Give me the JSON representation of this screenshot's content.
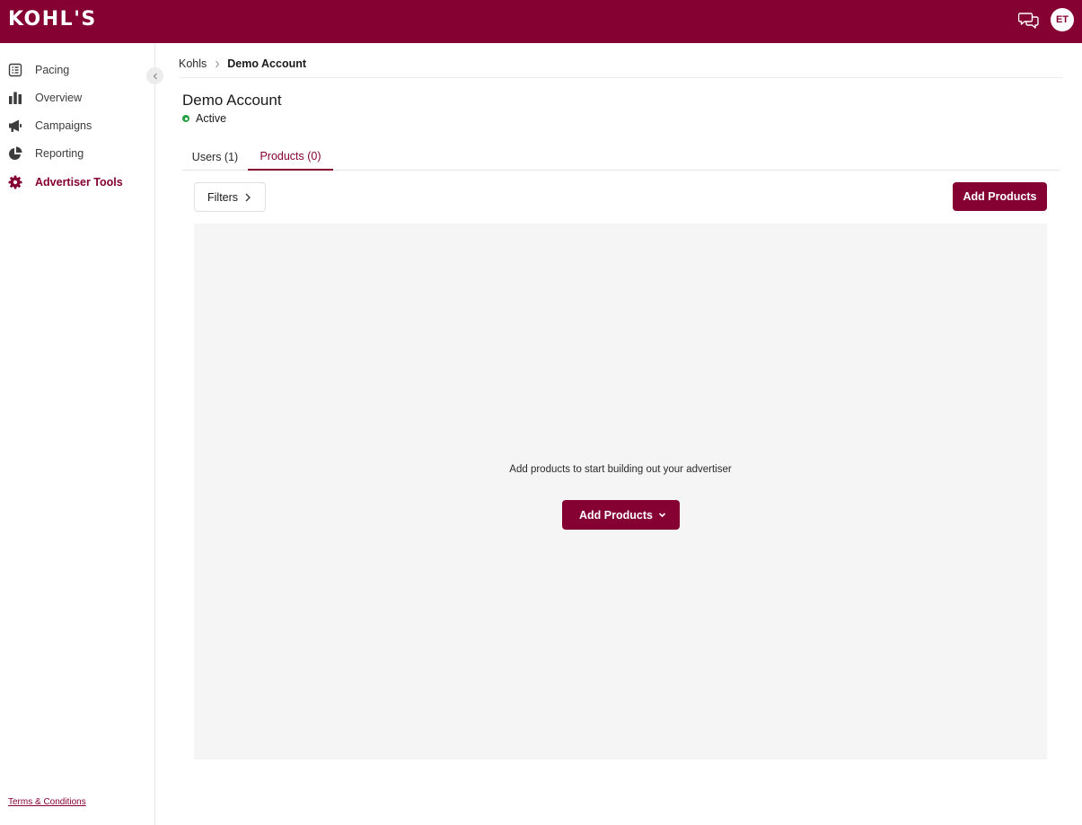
{
  "header": {
    "logo_text": "KOHL'S",
    "user_initials": "ET",
    "icons": {
      "chat": "chat-bubbles-icon"
    }
  },
  "sidebar": {
    "items": [
      {
        "label": "Pacing",
        "icon": "list-icon",
        "active": false
      },
      {
        "label": "Overview",
        "icon": "bar-chart-icon",
        "active": false
      },
      {
        "label": "Campaigns",
        "icon": "megaphone-icon",
        "active": false
      },
      {
        "label": "Reporting",
        "icon": "pie-chart-icon",
        "active": false
      },
      {
        "label": "Advertiser Tools",
        "icon": "gear-icon",
        "active": true
      }
    ],
    "footer_link": "Terms & Conditions"
  },
  "breadcrumb": {
    "root": "Kohls",
    "current": "Demo Account"
  },
  "account": {
    "title": "Demo Account",
    "status": "Active"
  },
  "tabs": [
    {
      "label": "Users (1)",
      "active": false
    },
    {
      "label": "Products (0)",
      "active": true
    }
  ],
  "toolbar": {
    "filters_label": "Filters",
    "add_products_label": "Add Products"
  },
  "empty_state": {
    "message": "Add products to start building out your advertiser",
    "button_label": "Add Products"
  },
  "colors": {
    "brand": "#840132",
    "status_active": "#27a243",
    "panel_bg": "#f5f5f5"
  }
}
